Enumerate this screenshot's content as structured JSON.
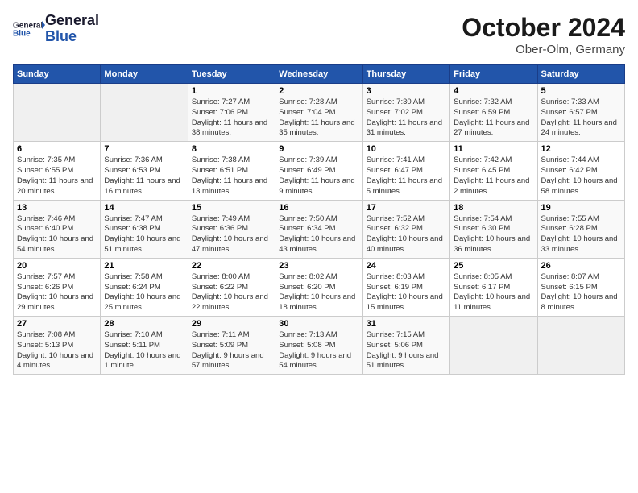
{
  "header": {
    "logo_line1": "General",
    "logo_line2": "Blue",
    "month": "October 2024",
    "location": "Ober-Olm, Germany"
  },
  "weekdays": [
    "Sunday",
    "Monday",
    "Tuesday",
    "Wednesday",
    "Thursday",
    "Friday",
    "Saturday"
  ],
  "weeks": [
    [
      {
        "day": "",
        "info": ""
      },
      {
        "day": "",
        "info": ""
      },
      {
        "day": "1",
        "info": "Sunrise: 7:27 AM\nSunset: 7:06 PM\nDaylight: 11 hours and 38 minutes."
      },
      {
        "day": "2",
        "info": "Sunrise: 7:28 AM\nSunset: 7:04 PM\nDaylight: 11 hours and 35 minutes."
      },
      {
        "day": "3",
        "info": "Sunrise: 7:30 AM\nSunset: 7:02 PM\nDaylight: 11 hours and 31 minutes."
      },
      {
        "day": "4",
        "info": "Sunrise: 7:32 AM\nSunset: 6:59 PM\nDaylight: 11 hours and 27 minutes."
      },
      {
        "day": "5",
        "info": "Sunrise: 7:33 AM\nSunset: 6:57 PM\nDaylight: 11 hours and 24 minutes."
      }
    ],
    [
      {
        "day": "6",
        "info": "Sunrise: 7:35 AM\nSunset: 6:55 PM\nDaylight: 11 hours and 20 minutes."
      },
      {
        "day": "7",
        "info": "Sunrise: 7:36 AM\nSunset: 6:53 PM\nDaylight: 11 hours and 16 minutes."
      },
      {
        "day": "8",
        "info": "Sunrise: 7:38 AM\nSunset: 6:51 PM\nDaylight: 11 hours and 13 minutes."
      },
      {
        "day": "9",
        "info": "Sunrise: 7:39 AM\nSunset: 6:49 PM\nDaylight: 11 hours and 9 minutes."
      },
      {
        "day": "10",
        "info": "Sunrise: 7:41 AM\nSunset: 6:47 PM\nDaylight: 11 hours and 5 minutes."
      },
      {
        "day": "11",
        "info": "Sunrise: 7:42 AM\nSunset: 6:45 PM\nDaylight: 11 hours and 2 minutes."
      },
      {
        "day": "12",
        "info": "Sunrise: 7:44 AM\nSunset: 6:42 PM\nDaylight: 10 hours and 58 minutes."
      }
    ],
    [
      {
        "day": "13",
        "info": "Sunrise: 7:46 AM\nSunset: 6:40 PM\nDaylight: 10 hours and 54 minutes."
      },
      {
        "day": "14",
        "info": "Sunrise: 7:47 AM\nSunset: 6:38 PM\nDaylight: 10 hours and 51 minutes."
      },
      {
        "day": "15",
        "info": "Sunrise: 7:49 AM\nSunset: 6:36 PM\nDaylight: 10 hours and 47 minutes."
      },
      {
        "day": "16",
        "info": "Sunrise: 7:50 AM\nSunset: 6:34 PM\nDaylight: 10 hours and 43 minutes."
      },
      {
        "day": "17",
        "info": "Sunrise: 7:52 AM\nSunset: 6:32 PM\nDaylight: 10 hours and 40 minutes."
      },
      {
        "day": "18",
        "info": "Sunrise: 7:54 AM\nSunset: 6:30 PM\nDaylight: 10 hours and 36 minutes."
      },
      {
        "day": "19",
        "info": "Sunrise: 7:55 AM\nSunset: 6:28 PM\nDaylight: 10 hours and 33 minutes."
      }
    ],
    [
      {
        "day": "20",
        "info": "Sunrise: 7:57 AM\nSunset: 6:26 PM\nDaylight: 10 hours and 29 minutes."
      },
      {
        "day": "21",
        "info": "Sunrise: 7:58 AM\nSunset: 6:24 PM\nDaylight: 10 hours and 25 minutes."
      },
      {
        "day": "22",
        "info": "Sunrise: 8:00 AM\nSunset: 6:22 PM\nDaylight: 10 hours and 22 minutes."
      },
      {
        "day": "23",
        "info": "Sunrise: 8:02 AM\nSunset: 6:20 PM\nDaylight: 10 hours and 18 minutes."
      },
      {
        "day": "24",
        "info": "Sunrise: 8:03 AM\nSunset: 6:19 PM\nDaylight: 10 hours and 15 minutes."
      },
      {
        "day": "25",
        "info": "Sunrise: 8:05 AM\nSunset: 6:17 PM\nDaylight: 10 hours and 11 minutes."
      },
      {
        "day": "26",
        "info": "Sunrise: 8:07 AM\nSunset: 6:15 PM\nDaylight: 10 hours and 8 minutes."
      }
    ],
    [
      {
        "day": "27",
        "info": "Sunrise: 7:08 AM\nSunset: 5:13 PM\nDaylight: 10 hours and 4 minutes."
      },
      {
        "day": "28",
        "info": "Sunrise: 7:10 AM\nSunset: 5:11 PM\nDaylight: 10 hours and 1 minute."
      },
      {
        "day": "29",
        "info": "Sunrise: 7:11 AM\nSunset: 5:09 PM\nDaylight: 9 hours and 57 minutes."
      },
      {
        "day": "30",
        "info": "Sunrise: 7:13 AM\nSunset: 5:08 PM\nDaylight: 9 hours and 54 minutes."
      },
      {
        "day": "31",
        "info": "Sunrise: 7:15 AM\nSunset: 5:06 PM\nDaylight: 9 hours and 51 minutes."
      },
      {
        "day": "",
        "info": ""
      },
      {
        "day": "",
        "info": ""
      }
    ]
  ]
}
